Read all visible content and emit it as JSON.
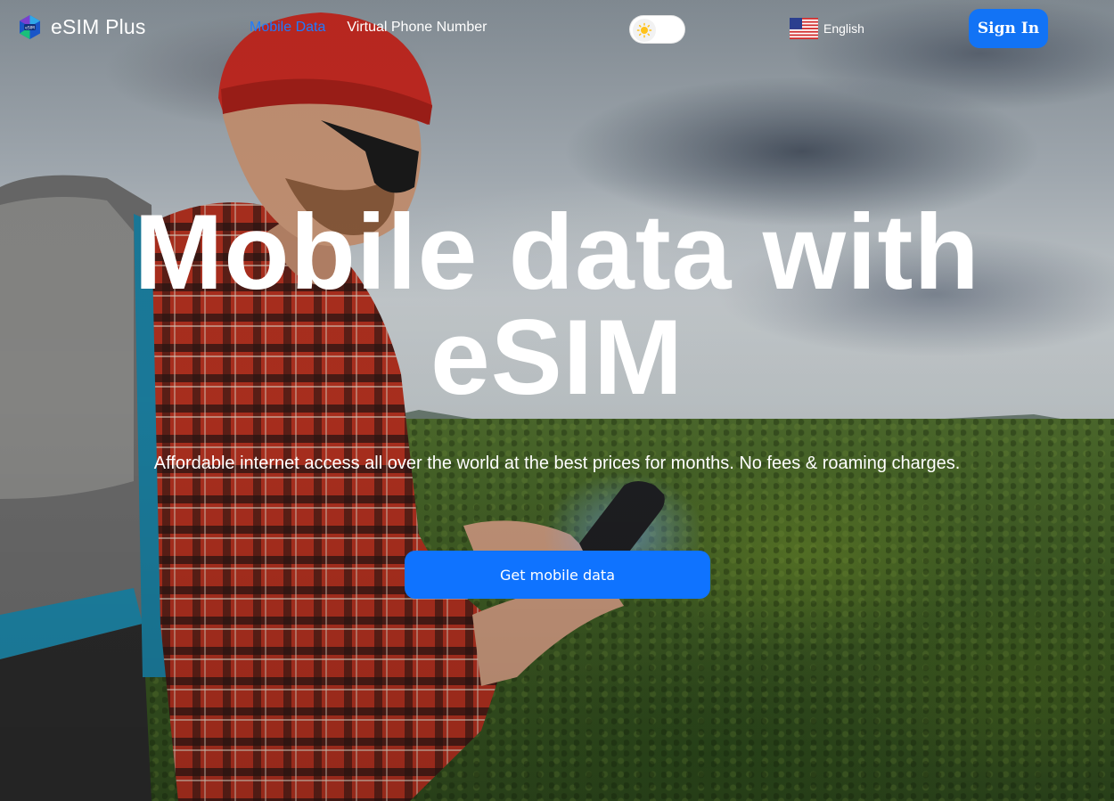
{
  "header": {
    "logo_text": "eSIM Plus",
    "logo_icon": "esim-plus-logo-icon",
    "nav": [
      {
        "label": "Mobile Data",
        "active": true
      },
      {
        "label": "Virtual Phone Number",
        "active": false
      }
    ],
    "theme_toggle_icon": "sun-icon",
    "language": {
      "label": "English",
      "flag_icon": "us-flag-icon"
    },
    "sign_in_label": "Sign In"
  },
  "hero": {
    "title_line1": "Mobile data with",
    "title_line2": "eSIM",
    "subtitle": "Affordable internet access all over the world at the best prices for months. No fees & roaming charges.",
    "cta_label": "Get mobile data"
  },
  "colors": {
    "accent": "#1273f5",
    "active_nav": "#1e7bff",
    "text": "#ffffff"
  }
}
